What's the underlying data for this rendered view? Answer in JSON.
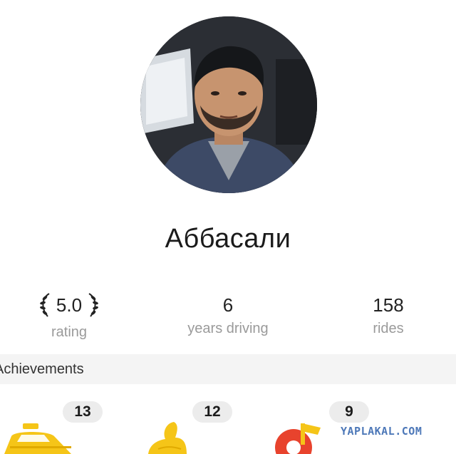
{
  "profile": {
    "name": "Аббасали"
  },
  "stats": {
    "rating": {
      "value": "5.0",
      "label": "rating"
    },
    "years": {
      "value": "6",
      "label": "years driving"
    },
    "rides": {
      "value": "158",
      "label": "rides"
    }
  },
  "achievements": {
    "title": "Achievements",
    "items": [
      {
        "count": "13",
        "icon": "taxi-car-icon",
        "color": "#f5c518"
      },
      {
        "count": "12",
        "icon": "thumbs-up-icon",
        "color": "#f5c518"
      },
      {
        "count": "9",
        "icon": "music-note-icon",
        "color": "#e8432d"
      }
    ]
  },
  "watermark": "YAPLAKAL.COM",
  "colors": {
    "muted_text": "#9a9a9a",
    "accent_yellow": "#f5c518",
    "accent_red": "#e8432d"
  }
}
